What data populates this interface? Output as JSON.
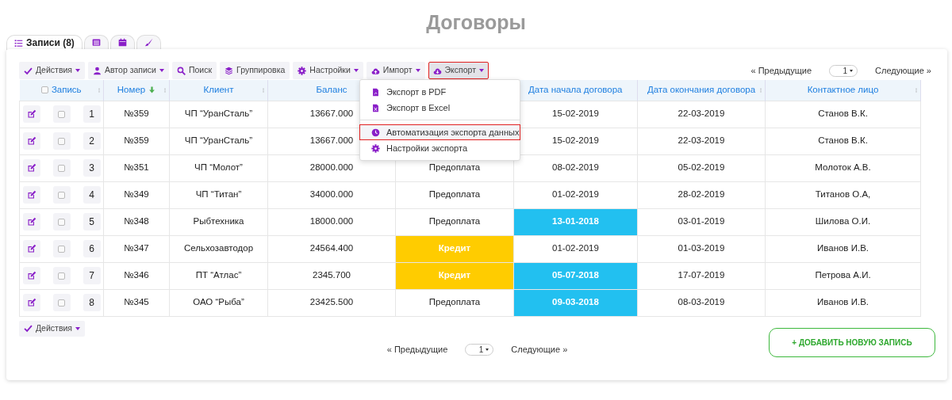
{
  "title": "Договоры",
  "tabs": [
    {
      "label": "Записи (8)",
      "selected": true
    },
    {
      "selected": false
    },
    {
      "selected": false
    },
    {
      "selected": false
    }
  ],
  "toolbar": [
    {
      "label": "Действия",
      "caret": true,
      "selected": false
    },
    {
      "label": "Автор записи",
      "caret": true,
      "selected": false
    },
    {
      "label": "Поиск",
      "caret": false,
      "selected": false
    },
    {
      "label": "Группировка",
      "caret": false,
      "selected": false
    },
    {
      "label": "Настройки",
      "caret": true,
      "selected": false
    },
    {
      "label": "Импорт",
      "caret": true,
      "selected": false
    },
    {
      "label": "Экспорт",
      "caret": true,
      "selected": true
    }
  ],
  "export_menu": [
    {
      "label": "Экспорт в PDF",
      "selected": false
    },
    {
      "label": "Экспорт в Excel",
      "selected": false
    },
    {
      "label": "Автоматизация экспорта данных",
      "selected": true
    },
    {
      "label": "Настройки экспорта",
      "selected": false
    }
  ],
  "pagination_top": {
    "prev": "« Предыдущие",
    "page": "1",
    "next": "Следующие »"
  },
  "table": {
    "columns": [
      {
        "label": "Запись",
        "checked": false
      },
      {
        "label": "Номер",
        "sorted": true
      },
      {
        "label": "Клиент"
      },
      {
        "label": "Баланс"
      },
      {
        "label": "Дата начала договора"
      },
      {
        "label": "Дата окончания договора"
      },
      {
        "label": "Контактное лицо"
      }
    ],
    "rows": [
      {
        "index": "1",
        "checked": false,
        "number": "№359",
        "client": "ЧП “УранСталь”",
        "balance": "13667.000",
        "start_date": {
          "text": "15-02-2019"
        },
        "end_date": "22-03-2019",
        "contact": "Станов В.К."
      },
      {
        "index": "2",
        "checked": false,
        "number": "№359",
        "client": "ЧП “УранСталь”",
        "balance": "13667.000",
        "start_date": {
          "text": "15-02-2019"
        },
        "end_date": "22-03-2019",
        "contact": "Станов В.К."
      },
      {
        "index": "3",
        "checked": false,
        "number": "№351",
        "client": "ЧП “Молот”",
        "balance": "28000.000",
        "column_5": {
          "text": "Предоплата"
        },
        "start_date": {
          "text": "08-02-2019"
        },
        "end_date": "05-02-2019",
        "contact": "Молоток А.В."
      },
      {
        "index": "4",
        "checked": false,
        "number": "№349",
        "client": "ЧП “Титан”",
        "balance": "34000.000",
        "column_5": {
          "text": "Предоплата"
        },
        "start_date": {
          "text": "01-02-2019"
        },
        "end_date": "28-02-2019",
        "contact": "Титанов О.А,"
      },
      {
        "index": "5",
        "checked": false,
        "number": "№348",
        "client": "Рыбтехника",
        "balance": "18000.000",
        "column_5": {
          "text": "Предоплата"
        },
        "start_date": {
          "text": "13-01-2018",
          "color": "#22c0f0"
        },
        "end_date": "03-01-2019",
        "contact": "Шилова О.И."
      },
      {
        "index": "6",
        "checked": false,
        "number": "№347",
        "client": "Сельхозавтодор",
        "balance": "24564.400",
        "column_5": {
          "text": "Кредит",
          "color": "#ffcc00"
        },
        "start_date": {
          "text": "01-02-2019"
        },
        "end_date": "01-03-2019",
        "contact": "Иванов И.В."
      },
      {
        "index": "7",
        "checked": false,
        "number": "№346",
        "client": "ПТ “Атлас”",
        "balance": "2345.700",
        "column_5": {
          "text": "Кредит",
          "color": "#ffcc00"
        },
        "start_date": {
          "text": "05-07-2018",
          "color": "#22c0f0"
        },
        "end_date": "17-07-2019",
        "contact": "Петрова А.И."
      },
      {
        "index": "8",
        "checked": false,
        "number": "№345",
        "client": "ОАО “Рыба”",
        "balance": "23425.500",
        "column_5": {
          "text": "Предоплата"
        },
        "start_date": {
          "text": "09-03-2018",
          "color": "#22c0f0"
        },
        "end_date": "08-03-2019",
        "contact": "Иванов И.В."
      }
    ]
  },
  "bottom_actions": {
    "label": "Действия"
  },
  "pagination_bottom": {
    "prev": "« Предыдущие",
    "page": "1",
    "next": "Следующие »"
  },
  "add_button": {
    "label": "+ ДОБАВИТЬ НОВУЮ ЗАПИСЬ"
  }
}
